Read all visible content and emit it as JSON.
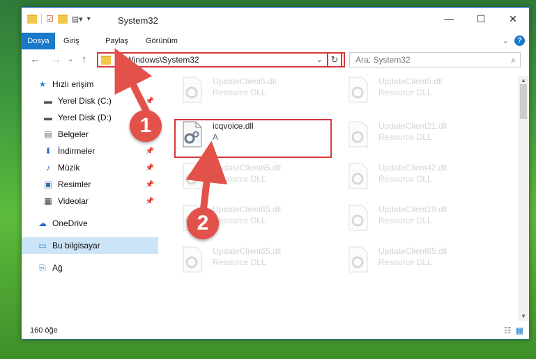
{
  "window": {
    "title": "System32",
    "controls": {
      "minimize": "—",
      "maximize": "☐",
      "close": "✕"
    }
  },
  "ribbon": {
    "tabs": [
      "Dosya",
      "Giriş",
      "Paylaş",
      "Görünüm"
    ],
    "help": "?"
  },
  "navigation": {
    "back": "←",
    "forward": "→",
    "up_chevron": "⌄",
    "up": "↑",
    "address": "C:\\Windows\\System32",
    "address_dropdown": "⌄",
    "refresh": "↻",
    "search_placeholder": "Ara: System32",
    "search_icon": "⌕"
  },
  "sidebar": {
    "items": [
      {
        "label": "Hızlı erişim",
        "icon": "star-icon",
        "glyph": "★",
        "color": "#2b88d8"
      },
      {
        "label": "Yerel Disk (C:)",
        "icon": "drive-icon",
        "glyph": "▬",
        "color": "#555555",
        "pinned": true
      },
      {
        "label": "Yerel Disk (D:)",
        "icon": "drive-icon",
        "glyph": "▬",
        "color": "#555555"
      },
      {
        "label": "Belgeler",
        "icon": "documents-icon",
        "glyph": "▤",
        "color": "#5a6a7a"
      },
      {
        "label": "İndirmeler",
        "icon": "download-icon",
        "glyph": "⬇",
        "color": "#2b6cc4",
        "pinned": true
      },
      {
        "label": "Müzik",
        "icon": "music-icon",
        "glyph": "♪",
        "color": "#2b6cc4",
        "pinned": true
      },
      {
        "label": "Resimler",
        "icon": "pictures-icon",
        "glyph": "▣",
        "color": "#3a6ea5",
        "pinned": true
      },
      {
        "label": "Videolar",
        "icon": "video-icon",
        "glyph": "▦",
        "color": "#333333",
        "pinned": true
      },
      {
        "label": "OneDrive",
        "icon": "cloud-icon",
        "glyph": "☁",
        "color": "#1e70c8"
      },
      {
        "label": "Bu bilgisayar",
        "icon": "computer-icon",
        "glyph": "▭",
        "color": "#2b88d8",
        "selected": true
      },
      {
        "label": "Ağ",
        "icon": "network-icon",
        "glyph": "⎘",
        "color": "#2b88d8"
      }
    ]
  },
  "files": [
    {
      "name": "UpdateClient5.dll",
      "desc": "Resource DLL"
    },
    {
      "name": "UpdateClient5.dll",
      "desc": "Resource DLL"
    },
    {
      "name": "icqvoice.dll",
      "desc": "A",
      "highlighted": true
    },
    {
      "name": "UpdateClient21.dll",
      "desc": "Resource DLL"
    },
    {
      "name": "UpdateClient65.dll",
      "desc": "Resource DLL"
    },
    {
      "name": "UpdateClient42.dll",
      "desc": "Resource DLL"
    },
    {
      "name": "UpdateClient65.dll",
      "desc": "Resource DLL"
    },
    {
      "name": "UpdateClient19.dll",
      "desc": "Resource DLL"
    },
    {
      "name": "UpdateClient65.dll",
      "desc": "Resource DLL"
    },
    {
      "name": "UpdateClient65.dll",
      "desc": "Resource DLL"
    }
  ],
  "status": {
    "count": "160 öğe",
    "details_view": "☷",
    "tiles_view": "▦"
  },
  "annotations": {
    "marker1": "1",
    "marker2": "2",
    "accent_color": "#d6373a"
  }
}
